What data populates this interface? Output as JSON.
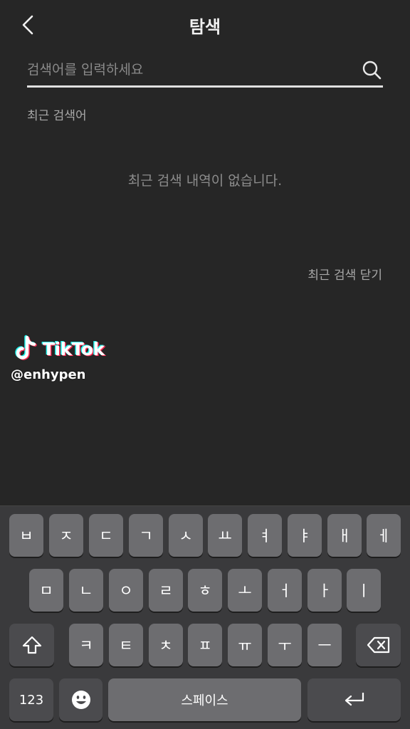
{
  "header": {
    "title": "탐색",
    "back_icon": "chevron-left-icon"
  },
  "search": {
    "placeholder": "검색어를 입력하세요",
    "value": "",
    "icon": "search-icon"
  },
  "recent": {
    "label": "최근 검색어",
    "empty_message": "최근 검색 내역이 없습니다.",
    "close_label": "최근 검색 닫기"
  },
  "watermark": {
    "brand": "TikTok",
    "handle": "@enhypen",
    "colors": {
      "cyan": "#25f4ee",
      "red": "#fe2c55"
    }
  },
  "keyboard": {
    "row1": [
      "ㅂ",
      "ㅈ",
      "ㄷ",
      "ㄱ",
      "ㅅ",
      "ㅛ",
      "ㅕ",
      "ㅑ",
      "ㅐ",
      "ㅔ"
    ],
    "row2": [
      "ㅁ",
      "ㄴ",
      "ㅇ",
      "ㄹ",
      "ㅎ",
      "ㅗ",
      "ㅓ",
      "ㅏ",
      "ㅣ"
    ],
    "row3": [
      "ㅋ",
      "ㅌ",
      "ㅊ",
      "ㅍ",
      "ㅠ",
      "ㅜ",
      "ㅡ"
    ],
    "numbers_label": "123",
    "space_label": "스페이스",
    "shift_icon": "shift-icon",
    "delete_icon": "backspace-icon",
    "emoji_icon": "emoji-icon",
    "return_icon": "return-icon"
  },
  "colors": {
    "background": "#262626",
    "keyboard_bg": "#3a3a3c",
    "key": "#6d6d70",
    "function_key": "#4b4b4e"
  }
}
